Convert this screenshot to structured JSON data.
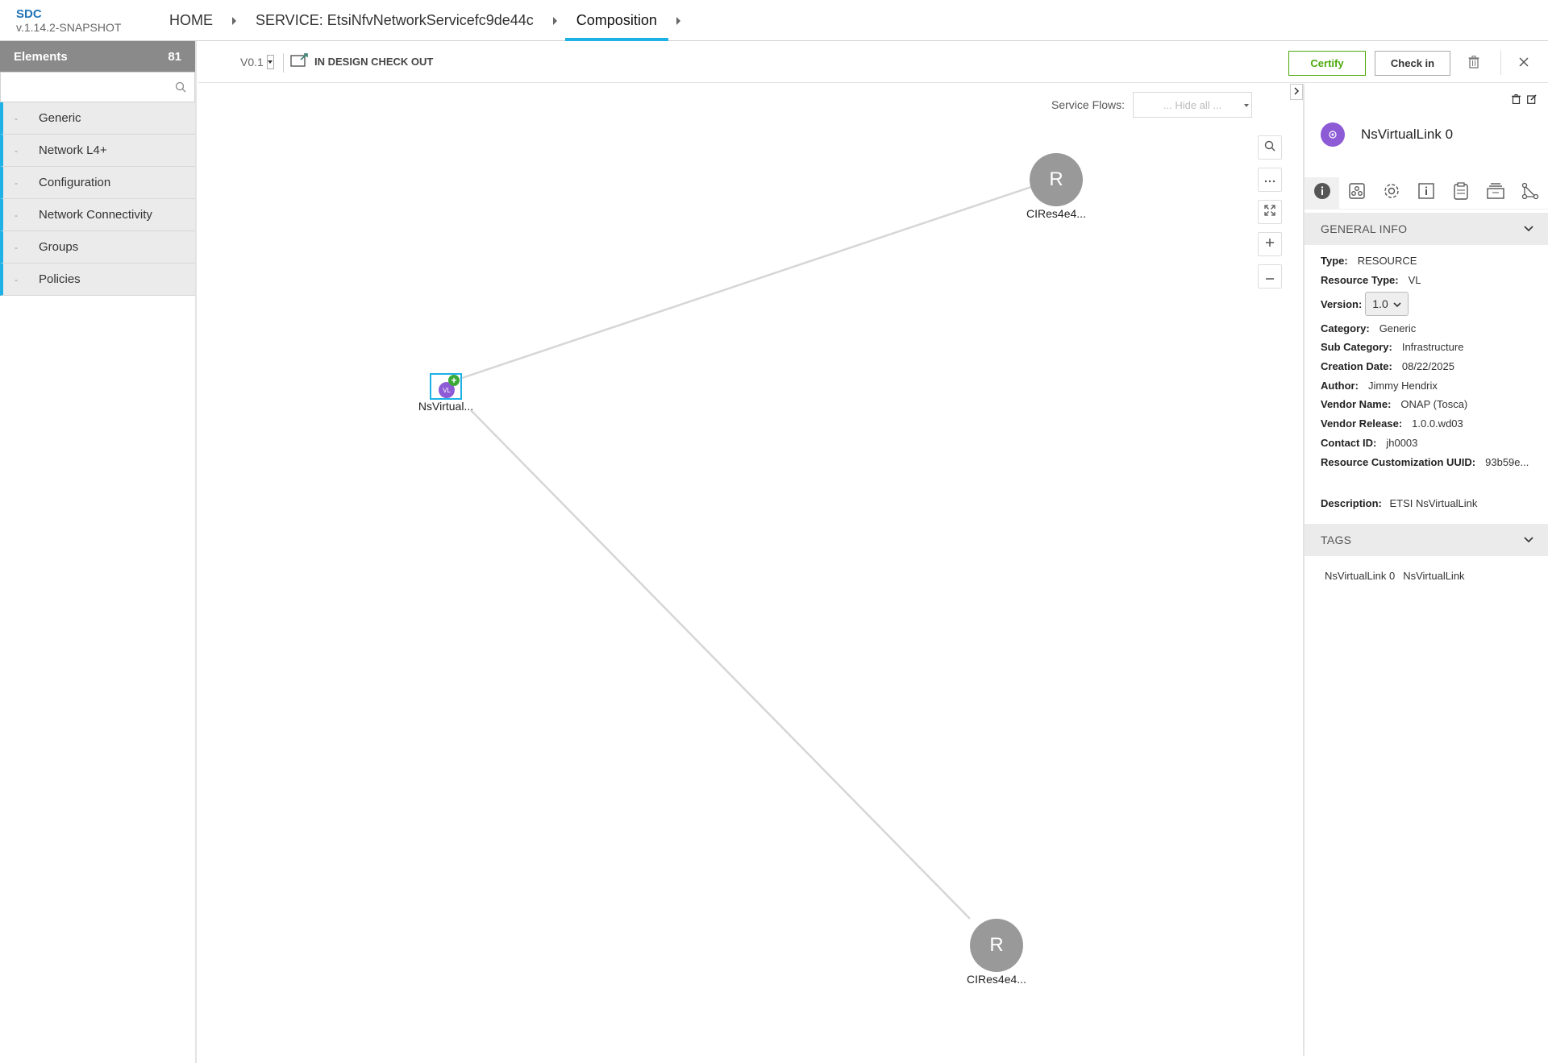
{
  "app": {
    "name": "SDC",
    "version": "v.1.14.2-SNAPSHOT"
  },
  "breadcrumb": [
    {
      "label": "HOME"
    },
    {
      "label": "SERVICE: EtsiNfvNetworkServicefc9de44c"
    },
    {
      "label": "Composition"
    }
  ],
  "palette": {
    "title": "Elements",
    "count": "81",
    "search_placeholder": "",
    "categories": [
      {
        "label": "Generic"
      },
      {
        "label": "Network L4+"
      },
      {
        "label": "Configuration"
      },
      {
        "label": "Network Connectivity"
      },
      {
        "label": "Groups"
      },
      {
        "label": "Policies"
      }
    ]
  },
  "toolbar": {
    "version": "V0.1",
    "status": "IN DESIGN CHECK OUT",
    "certify_label": "Certify",
    "checkin_label": "Check in"
  },
  "canvas": {
    "service_flows_label": "Service Flows:",
    "service_flows_value": "... Hide all ...",
    "nodes": [
      {
        "icon_text": "R",
        "label": "CIRes4e4..."
      },
      {
        "icon_text": "VL",
        "label": "NsVirtual..."
      },
      {
        "icon_text": "R",
        "label": "CIRes4e4..."
      }
    ],
    "zoom_controls": [
      "search-icon",
      "more-icon",
      "fit-icon",
      "zoom-in-icon",
      "zoom-out-icon"
    ]
  },
  "panel": {
    "title": "NsVirtualLink 0",
    "tabs": [
      "info-icon",
      "deployment-icon",
      "settings-icon",
      "inputs-icon",
      "artifacts-icon",
      "api-icon",
      "relations-icon"
    ],
    "general_info_title": "GENERAL INFO",
    "info": {
      "type": {
        "k": "Type:",
        "v": "RESOURCE"
      },
      "resource_type": {
        "k": "Resource Type:",
        "v": "VL"
      },
      "version": {
        "k": "Version:",
        "v": "1.0"
      },
      "category": {
        "k": "Category:",
        "v": "Generic"
      },
      "sub_category": {
        "k": "Sub Category:",
        "v": "Infrastructure"
      },
      "creation_date": {
        "k": "Creation Date:",
        "v": "08/22/2025"
      },
      "author": {
        "k": "Author:",
        "v": "Jimmy Hendrix"
      },
      "vendor_name": {
        "k": "Vendor Name:",
        "v": "ONAP (Tosca)"
      },
      "vendor_release": {
        "k": "Vendor Release:",
        "v": "1.0.0.wd03"
      },
      "contact_id": {
        "k": "Contact ID:",
        "v": "jh0003"
      },
      "customization_uuid": {
        "k": "Resource Customization UUID:",
        "v": "93b59e..."
      }
    },
    "description": {
      "k": "Description:",
      "v": "ETSI NsVirtualLink"
    },
    "tags_title": "TAGS",
    "tags": [
      "NsVirtualLink 0",
      "NsVirtualLink"
    ]
  },
  "colors": {
    "accent": "#1db1e6",
    "certify": "#4ca90c",
    "vl_purple": "#8e5bd6",
    "node_grey": "#999999"
  }
}
